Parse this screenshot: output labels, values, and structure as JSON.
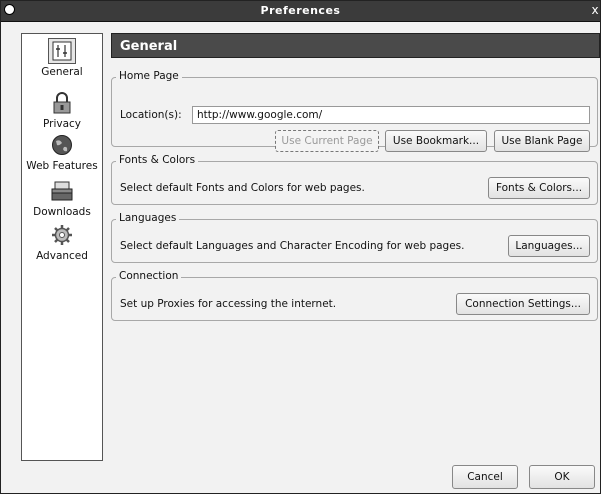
{
  "window": {
    "title": "Preferences",
    "close_glyph": "x"
  },
  "sidebar": {
    "items": [
      {
        "label": "General",
        "icon": "general-icon",
        "selected": true
      },
      {
        "label": "Privacy",
        "icon": "lock-icon"
      },
      {
        "label": "Web Features",
        "icon": "globe-icon"
      },
      {
        "label": "Downloads",
        "icon": "download-icon"
      },
      {
        "label": "Advanced",
        "icon": "gear-icon"
      }
    ]
  },
  "main": {
    "header": "General",
    "home_page": {
      "legend": "Home Page",
      "location_label": "Location(s):",
      "location_value": "http://www.google.com/",
      "use_current_page": "Use Current Page",
      "use_bookmark": "Use Bookmark...",
      "use_blank_page": "Use Blank Page"
    },
    "fonts_colors": {
      "legend": "Fonts & Colors",
      "description": "Select default Fonts and Colors for web pages.",
      "button": "Fonts & Colors..."
    },
    "languages": {
      "legend": "Languages",
      "description": "Select default Languages and Character Encoding for web pages.",
      "button": "Languages..."
    },
    "connection": {
      "legend": "Connection",
      "description": "Set up Proxies for accessing the internet.",
      "button": "Connection Settings..."
    }
  },
  "footer": {
    "cancel": "Cancel",
    "ok": "OK"
  }
}
